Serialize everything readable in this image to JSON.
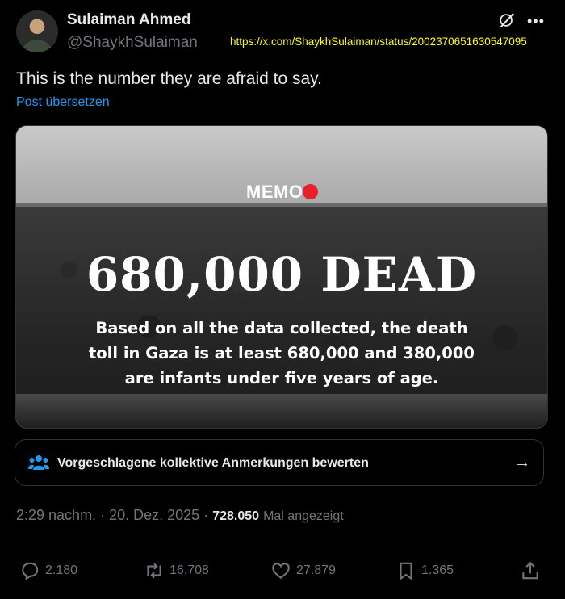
{
  "author": {
    "name": "Sulaiman Ahmed",
    "handle": "@ShaykhSulaiman"
  },
  "annotation_url": "https://x.com/ShaykhSulaiman/status/2002370651630547095",
  "header_icons": [
    "grok-icon",
    "more-icon"
  ],
  "post": {
    "text": "This is the number they are afraid to say.",
    "translate_label": "Post übersetzen"
  },
  "media": {
    "logo_text": "MEMO",
    "headline": "680,000 DEAD",
    "subtext_lines": [
      "Based on all the data collected, the death",
      "toll in Gaza is at least 680,000 and 380,000",
      "are infants under five years of age."
    ]
  },
  "community_notes": {
    "label": "Vorgeschlagene kollektive Anmerkungen bewerten",
    "icon": "people-icon"
  },
  "meta": {
    "time": "2:29 nachm.",
    "separator": "·",
    "date": "20. Dez. 2025",
    "views_count": "728.050",
    "views_label": "Mal angezeigt"
  },
  "actions": {
    "replies": "2.180",
    "reposts": "16.708",
    "likes": "27.879",
    "bookmarks": "1.365"
  },
  "colors": {
    "background": "#000000",
    "link": "#1d9bf0",
    "annotation": "#ffff00",
    "memo_red": "#e8202a"
  }
}
